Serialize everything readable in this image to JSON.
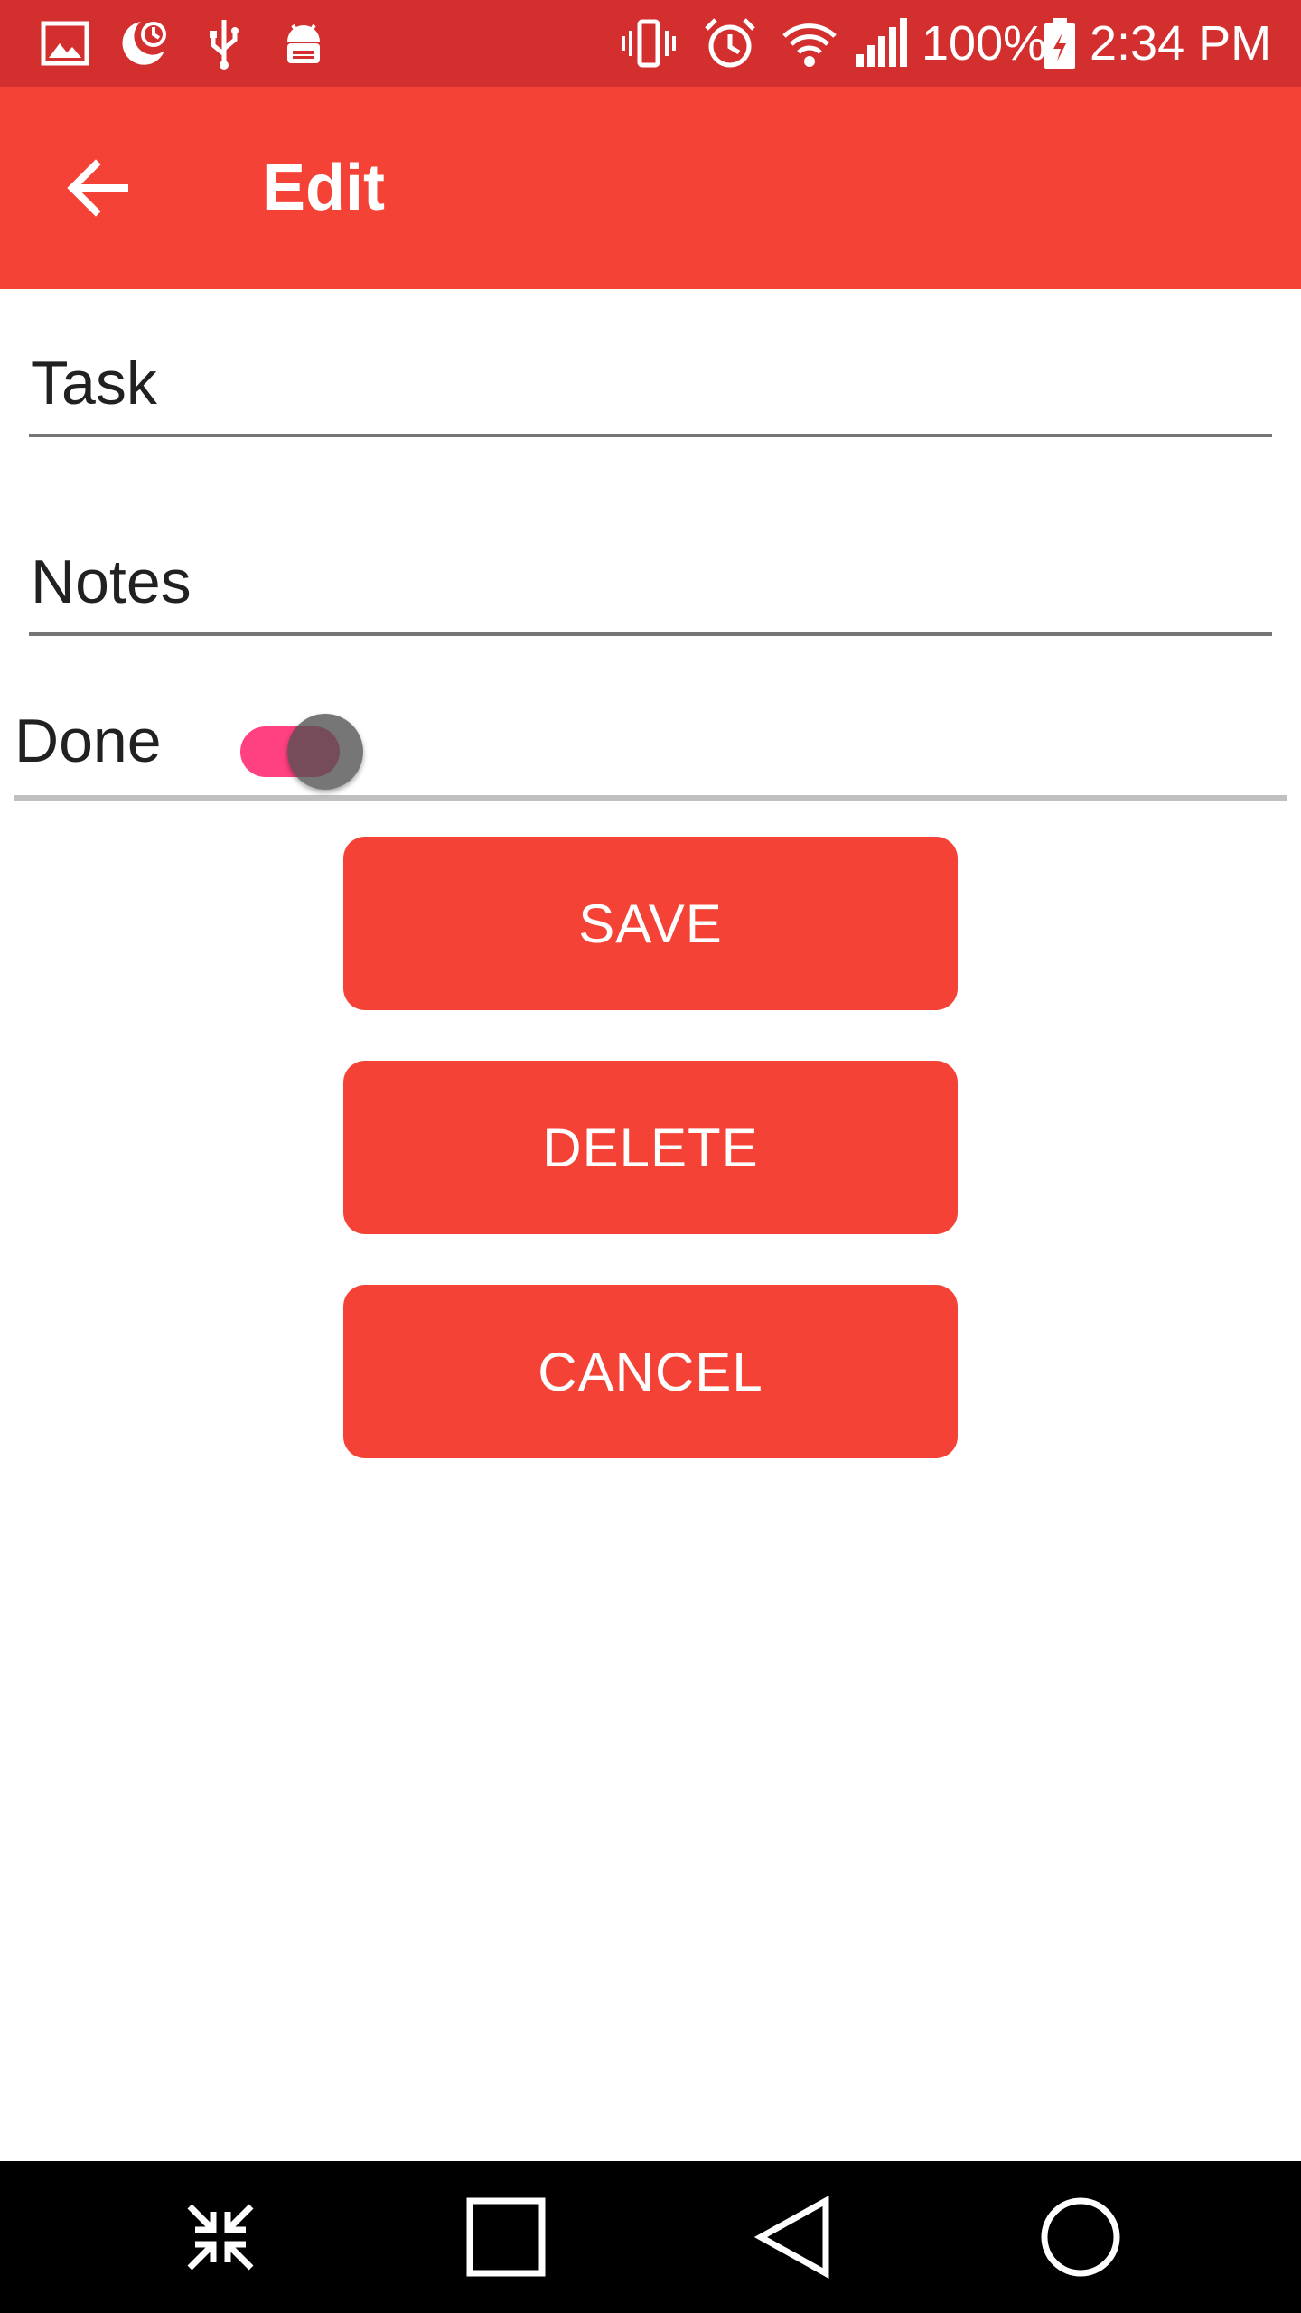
{
  "status_bar": {
    "battery_percent": "100%",
    "time": "2:34 PM",
    "icons": [
      "image-icon",
      "do-not-disturb-icon",
      "usb-icon",
      "android-debug-icon",
      "vibrate-icon",
      "alarm-icon",
      "wifi-icon",
      "signal-icon",
      "battery-charging-icon"
    ]
  },
  "app_bar": {
    "title": "Edit",
    "back_icon": "arrow-back-icon"
  },
  "form": {
    "task_placeholder": "Task",
    "task_value": "",
    "notes_placeholder": "Notes",
    "notes_value": "",
    "done_label": "Done",
    "done_checked": true
  },
  "buttons": {
    "save": "SAVE",
    "delete": "DELETE",
    "cancel": "CANCEL"
  },
  "nav_bar": {
    "icons": [
      "minimize-icon",
      "recents-icon",
      "back-triangle-icon",
      "home-icon"
    ]
  },
  "colors": {
    "status_bar": "#d32f2f",
    "primary": "#f44336",
    "switch_track": "#ff4081",
    "nav_bar": "#000000"
  }
}
